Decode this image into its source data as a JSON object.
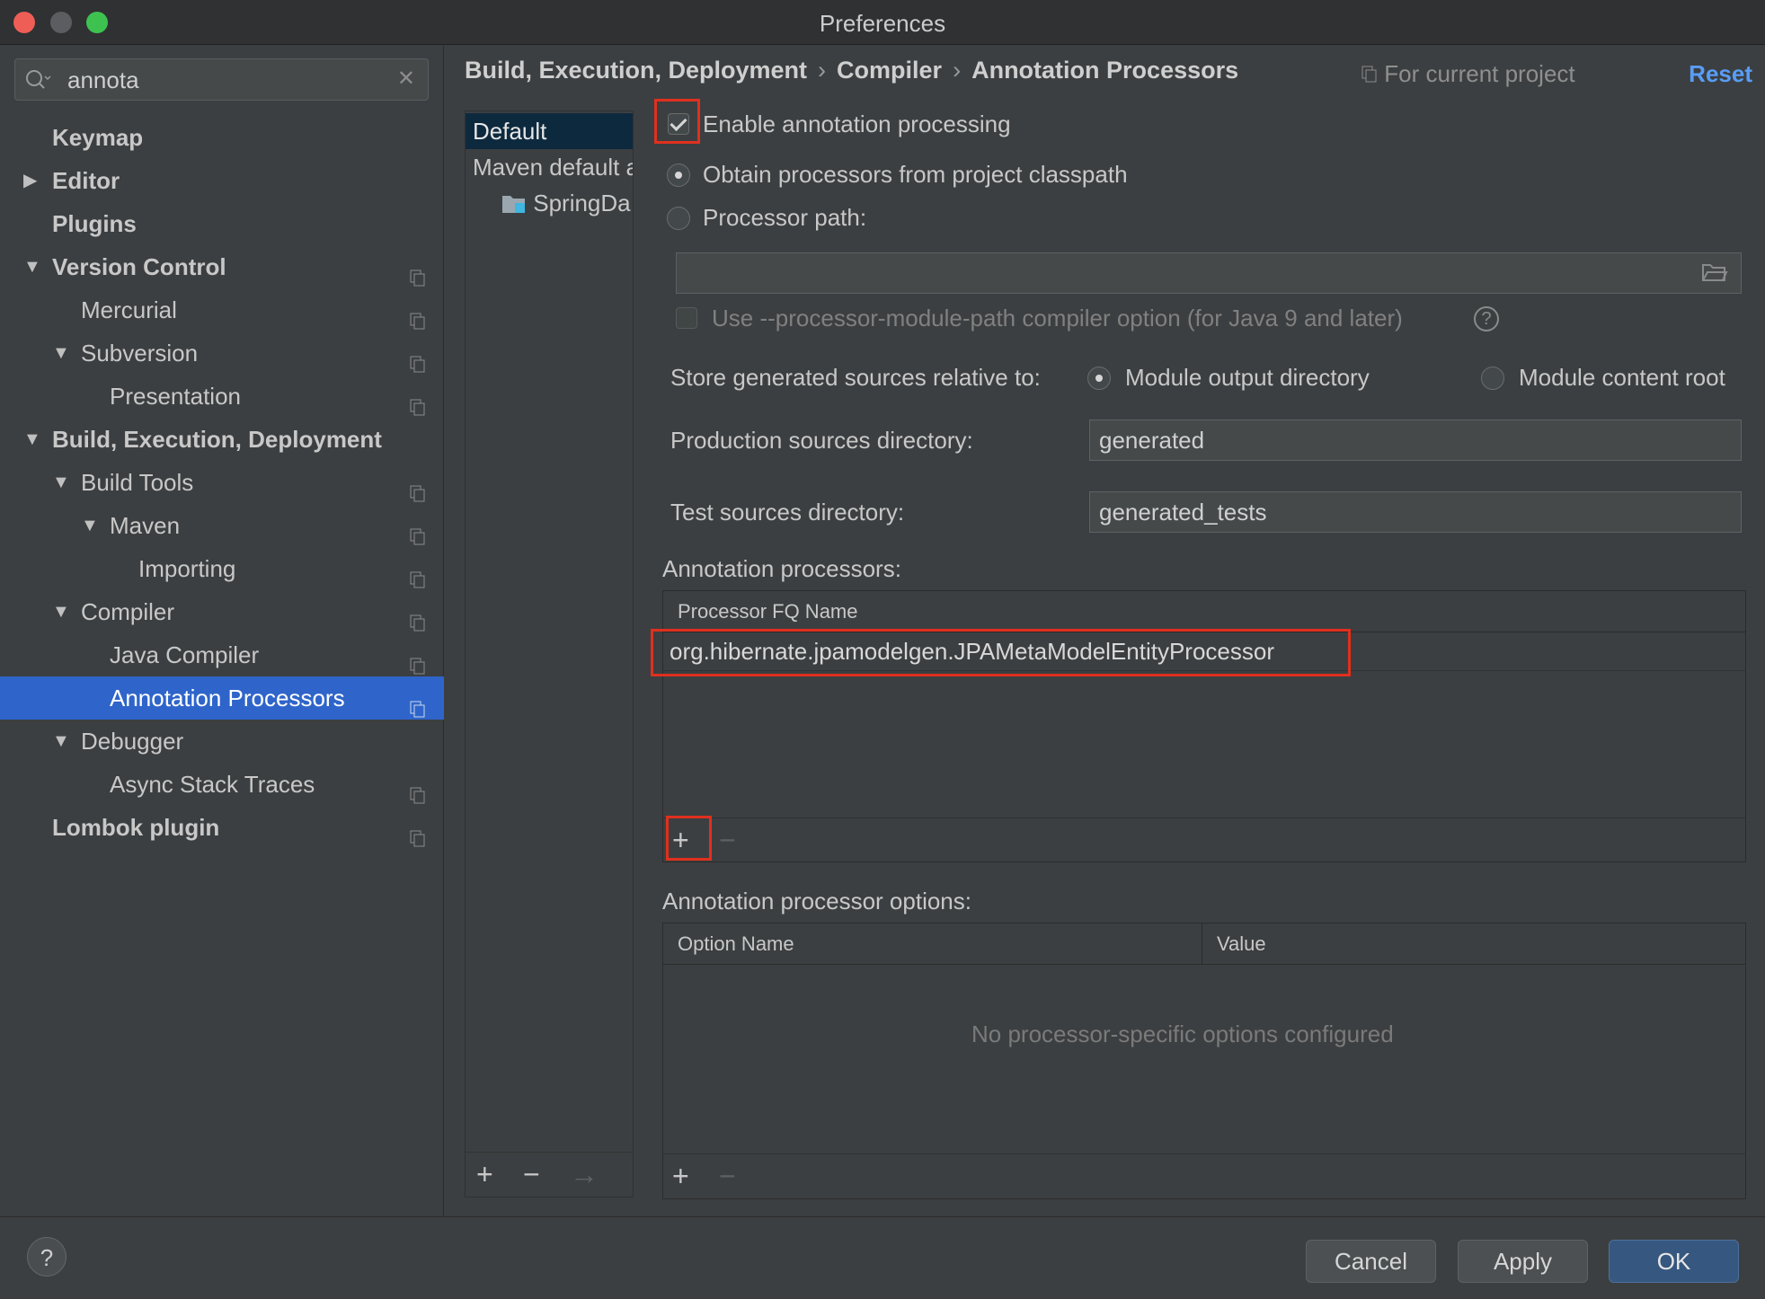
{
  "window": {
    "title": "Preferences"
  },
  "search": {
    "value": "annota"
  },
  "sidebar": {
    "items": [
      {
        "label": "Keymap",
        "bold": true
      },
      {
        "label": "Editor",
        "bold": true
      },
      {
        "label": "Plugins",
        "bold": true
      },
      {
        "label": "Version Control",
        "bold": true
      },
      {
        "label": "Mercurial"
      },
      {
        "label": "Subversion"
      },
      {
        "label": "Presentation"
      },
      {
        "label": "Build, Execution, Deployment",
        "bold": true
      },
      {
        "label": "Build Tools"
      },
      {
        "label": "Maven"
      },
      {
        "label": "Importing"
      },
      {
        "label": "Compiler"
      },
      {
        "label": "Java Compiler"
      },
      {
        "label": "Annotation Processors",
        "selected": true
      },
      {
        "label": "Debugger"
      },
      {
        "label": "Async Stack Traces"
      },
      {
        "label": "Lombok plugin",
        "bold": true
      }
    ]
  },
  "breadcrumb": [
    "Build, Execution, Deployment",
    "Compiler",
    "Annotation Processors"
  ],
  "header": {
    "for_project": "For current project",
    "reset": "Reset"
  },
  "profiles": {
    "items": [
      "Default",
      "Maven default annotation processors profile",
      "SpringDa"
    ]
  },
  "form": {
    "enable_label": "Enable annotation processing",
    "enable_checked": true,
    "obtain_label": "Obtain processors from project classpath",
    "processor_path_label": "Processor path:",
    "processor_path_value": "",
    "module_path_label": "Use --processor-module-path compiler option (for Java 9 and later)",
    "module_path_help": "?",
    "store_label": "Store generated sources relative to:",
    "module_output_label": "Module output directory",
    "module_content_label": "Module content root",
    "production_label": "Production sources directory:",
    "production_value": "generated",
    "test_label": "Test sources directory:",
    "test_value": "generated_tests"
  },
  "processors": {
    "title": "Annotation processors:",
    "column": "Processor FQ Name",
    "rows": [
      "org.hibernate.jpamodelgen.JPAMetaModelEntityProcessor"
    ]
  },
  "options": {
    "title": "Annotation processor options:",
    "columns": [
      "Option Name",
      "Value"
    ],
    "empty_text": "No processor-specific options configured"
  },
  "toolbar": {
    "add": "+",
    "remove": "−",
    "move": "→"
  },
  "footer": {
    "help": "?",
    "cancel": "Cancel",
    "apply": "Apply",
    "ok": "OK"
  },
  "colors": {
    "accent": "#2f65ca",
    "highlight": "#e0301e",
    "link": "#589df6"
  }
}
